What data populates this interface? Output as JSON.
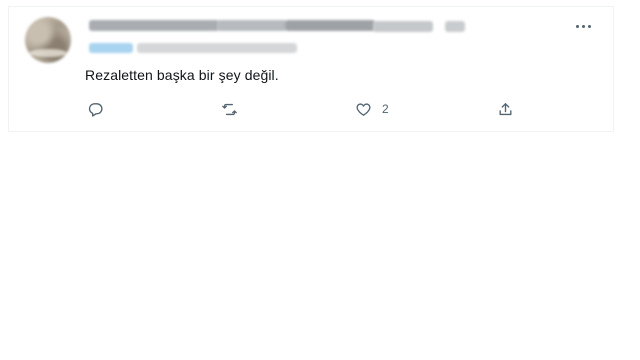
{
  "tweet": {
    "text": "Rezaletten başka bir şey değil.",
    "like_count": "2"
  },
  "icons": {
    "reply": "reply-icon",
    "retweet": "retweet-icon",
    "like": "heart-icon",
    "share": "share-icon",
    "more": "more-icon"
  },
  "colors": {
    "text": "#0f1419",
    "secondary": "#536471",
    "border": "#eff3f4"
  }
}
